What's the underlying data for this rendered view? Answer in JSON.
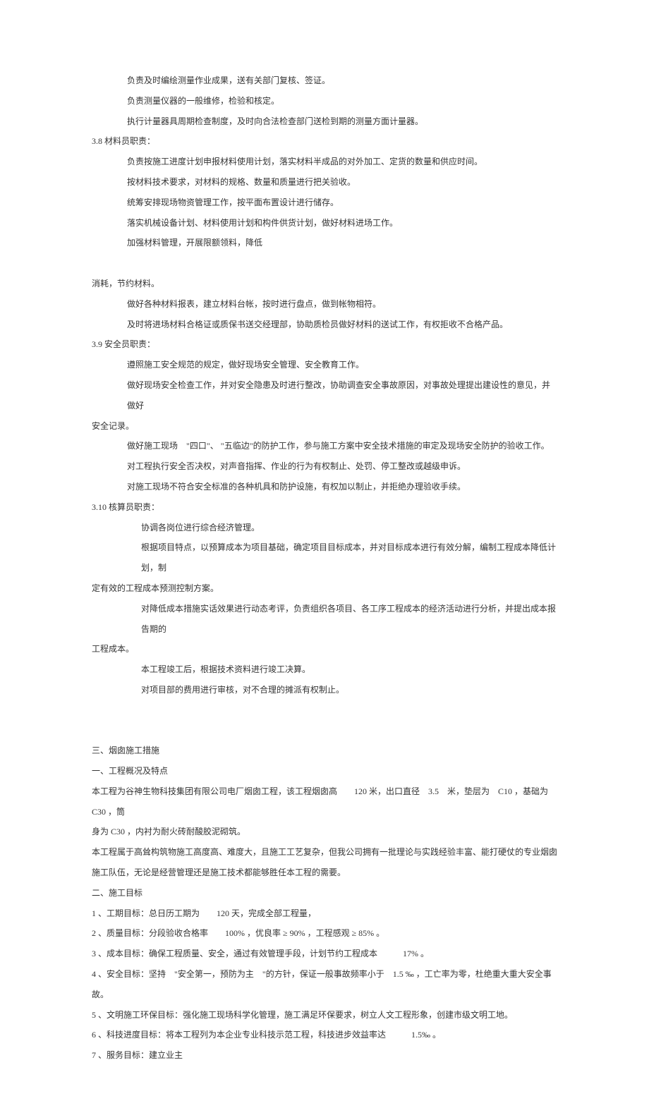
{
  "lines": [
    {
      "cls": "indent-1",
      "text": "负责及时编绘测量作业成果，送有关部门复核、签证。"
    },
    {
      "cls": "indent-1",
      "text": "负责测量仪器的一般维修，检验和核定。"
    },
    {
      "cls": "indent-1",
      "text": "执行计量器具周期检查制度，及时向合法检查部门送检到期的测量方面计量器。"
    },
    {
      "cls": "num-hdr",
      "text": "3.8  材料员职责："
    },
    {
      "cls": "indent-1",
      "text": "负责按施工进度计划申报材料使用计划，落实材料半成品的对外加工、定货的数量和供应时间。"
    },
    {
      "cls": "indent-1",
      "text": "按材料技术要求，对材料的规格、数量和质量进行把关验收。"
    },
    {
      "cls": "indent-1",
      "text": "统筹安排现场物资管理工作，按平面布置设计进行储存。"
    },
    {
      "cls": "indent-1",
      "text": "落实机械设备计划、材料使用计划和构件供货计划，做好材料进场工作。"
    },
    {
      "cls": "indent-1",
      "text": "加强材料管理，开展限额领料，降低"
    },
    {
      "cls": "section-head",
      "text": " "
    },
    {
      "cls": "section-head",
      "text": "消耗，节约材料。"
    },
    {
      "cls": "indent-1",
      "text": "做好各种材料报表，建立材料台帐，按时进行盘点，做到帐物相符。"
    },
    {
      "cls": "indent-1",
      "text": "及时将进场材料合格证或质保书送交经理部，协助质检员做好材料的送试工作，有权拒收不合格产品。"
    },
    {
      "cls": "num-hdr",
      "text": "3.9   安全员职责："
    },
    {
      "cls": "indent-1",
      "text": "遵照施工安全规范的规定，做好现场安全管理、安全教育工作。"
    },
    {
      "cls": "indent-1",
      "text": "做好现场安全检查工作，并对安全隐患及时进行整改，协助调查安全事故原因，对事故处理提出建设性的意见，并做好"
    },
    {
      "cls": "section-head",
      "text": "安全记录。"
    },
    {
      "cls": "indent-1",
      "text": "做好施工现场　\"四口\"、 \"五临边\"的防护工作，参与施工方案中安全技术措施的审定及现场安全防护的验收工作。"
    },
    {
      "cls": "indent-1",
      "text": "对工程执行安全否决权，对声音指挥、作业的行为有权制止、处罚、停工整改或越级申诉。"
    },
    {
      "cls": "indent-1",
      "text": "对施工现场不符合安全标准的各种机具和防护设施，有权加以制止，并拒绝办理验收手续。"
    },
    {
      "cls": "num-hdr",
      "text": "3.10   核算员职责："
    },
    {
      "cls": "indent-2",
      "text": "协调各岗位进行综合经济管理。"
    },
    {
      "cls": "indent-2",
      "text": "根据项目特点，以预算成本为项目基础，确定项目目标成本，并对目标成本进行有效分解，编制工程成本降低计划，制"
    },
    {
      "cls": "section-head",
      "text": "定有效的工程成本预测控制方案。"
    },
    {
      "cls": "indent-2",
      "text": "对降低成本措施实话效果进行动态考评，负责组织各项目、各工序工程成本的经济活动进行分析，并提出成本报告期的"
    },
    {
      "cls": "section-head",
      "text": "工程成本。"
    },
    {
      "cls": "indent-2",
      "text": "本工程竣工后，根据技术资料进行竣工决算。"
    },
    {
      "cls": "indent-2",
      "text": "对项目部的费用进行审核，对不合理的摊派有权制止。"
    },
    {
      "cls": "section-head",
      "text": " "
    },
    {
      "cls": "section-head",
      "text": " "
    },
    {
      "cls": "section-head",
      "text": "三、烟囱施工措施"
    },
    {
      "cls": "section-head",
      "text": "一、工程概况及特点"
    },
    {
      "cls": "section-head",
      "text": "本工程为谷神生物科技集团有限公司电厂烟囱工程，该工程烟囱高　　120 米，出口直径　3.5　米，垫层为　C10 ，基础为　C30 ，筒"
    },
    {
      "cls": "section-head",
      "text": "身为 C30 ，内衬为耐火砖耐酸胶泥砌筑。"
    },
    {
      "cls": "section-head",
      "text": "本工程属于高耸构筑物施工高度高、难度大，且施工工艺复杂，但我公司拥有一批理论与实践经验丰富、能打硬仗的专业烟囱"
    },
    {
      "cls": "section-head",
      "text": "施工队伍，无论是经营管理还是施工技术都能够胜任本工程的需要。"
    },
    {
      "cls": "section-head",
      "text": "二、施工目标"
    },
    {
      "cls": "section-head",
      "text": "1 、工期目标：总日历工期为　　120 天，完成全部工程量，"
    },
    {
      "cls": "section-head",
      "text": "2 、质量目标：分段验收合格率　　100% ，优良率 ≥ 90% ，工程感观 ≥ 85% 。"
    },
    {
      "cls": "section-head",
      "text": "3 、成本目标：确保工程质量、安全，通过有效管理手段，计划节约工程成本　　　17% 。"
    },
    {
      "cls": "section-head",
      "text": "4 、安全目标：坚持　\"安全第一，预防为主　\"的方针，保证一般事故频率小于　1.5 ‰ ，工亡率为零，杜绝重大重大安全事故。"
    },
    {
      "cls": "section-head",
      "text": "5 、文明施工环保目标：强化施工现场科学化管理，施工满足环保要求，树立人文工程形象，创建市级文明工地。"
    },
    {
      "cls": "section-head",
      "text": "6 、科技进度目标：将本工程列为本企业专业科技示范工程，科技进步效益率达　　　1.5‰ 。"
    },
    {
      "cls": "section-head",
      "text": "7 、服务目标：建立业主"
    }
  ]
}
